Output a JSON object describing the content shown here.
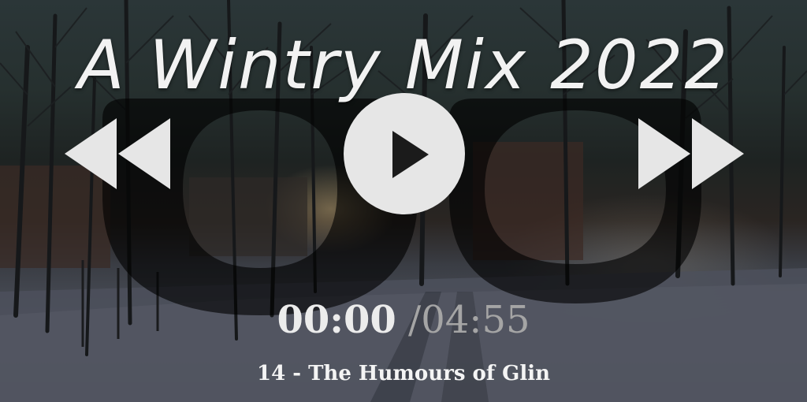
{
  "player": {
    "title": "A Wintry Mix 2022",
    "time_current": "00:00",
    "time_separator": "/",
    "time_total": "04:55",
    "track_title": "14 - The Humours of Glin"
  },
  "icons": {
    "rewind": "rewind-icon",
    "play": "play-icon",
    "fast_forward": "fast-forward-icon",
    "glasses": "glasses-icon"
  },
  "colors": {
    "controls": "#e6e6e6",
    "play_triangle": "#1b1b1b",
    "text_primary": "#f2f2f2",
    "text_muted": "#a5a5a5"
  }
}
